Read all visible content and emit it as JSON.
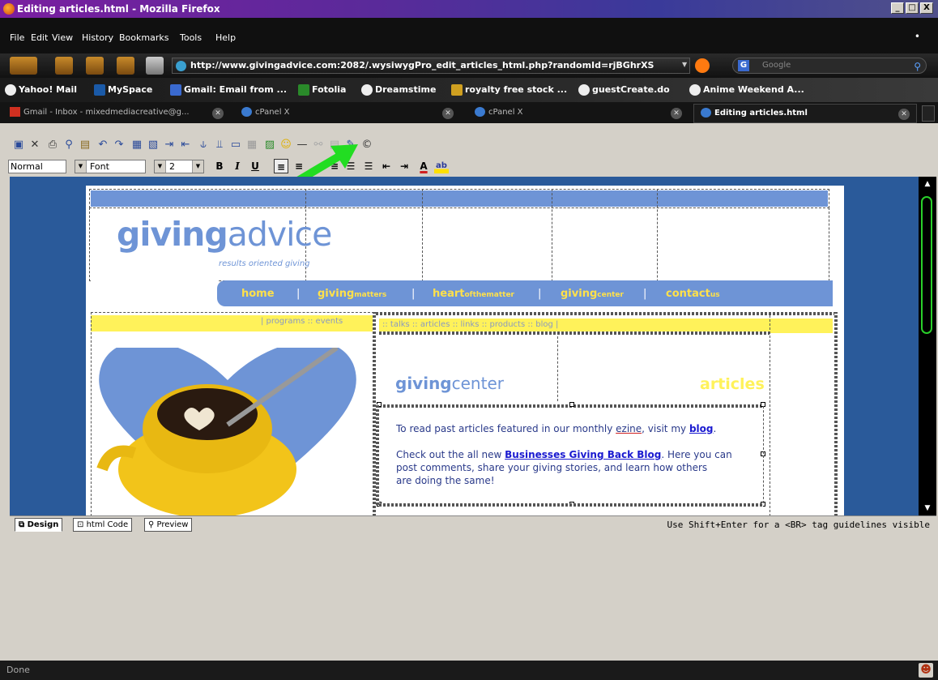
{
  "window": {
    "title": "Editing articles.html - Mozilla Firefox",
    "controls": [
      "_",
      "□",
      "X"
    ]
  },
  "menu": [
    "File",
    "Edit",
    "View",
    "History",
    "Bookmarks",
    "Tools",
    "Help"
  ],
  "address": {
    "url": "http://www.givingadvice.com:2082/.wysiwygPro_edit_articles_html.php?randomId=rjBGhrXS"
  },
  "search": {
    "placeholder": "Google"
  },
  "bookmarks": [
    "Yahoo! Mail",
    "MySpace",
    "Gmail: Email from ...",
    "Fotolia",
    "Dreamstime",
    "royalty free stock ...",
    "guestCreate.do",
    "Anime Weekend A..."
  ],
  "tabs": [
    {
      "label": "Gmail - Inbox - mixedmediacreative@g..."
    },
    {
      "label": "cPanel X"
    },
    {
      "label": "cPanel X"
    },
    {
      "label": "Editing articles.html"
    }
  ],
  "format": {
    "style": "Normal",
    "font": "Font",
    "size": "2"
  },
  "site": {
    "logo_bold": "giving",
    "logo_light": "advice",
    "tagline": "results oriented giving",
    "nav": [
      {
        "bold": "home",
        "small": ""
      },
      {
        "bold": "giving",
        "small": "matters"
      },
      {
        "bold": "heart",
        "small": "ofthematter"
      },
      {
        "bold": "giving",
        "small": "center"
      },
      {
        "bold": "contact",
        "small": "us"
      }
    ],
    "left_links": "|   programs  ::  events",
    "right_links": "::  talks  ::  articles  ::  links  ::  products  ::  blog   |",
    "section_bold": "giving",
    "section_light": "center",
    "articles_heading": "articles",
    "p1_before": "To read past articles featured in our monthly ",
    "p1_ezine": "ezine",
    "p1_mid": ", visit my ",
    "p1_link": "blog",
    "p1_end": ".",
    "p2_before": "Check out the all new ",
    "p2_link": "Businesses Giving Back Blog",
    "p2_rest1": ". Here you can",
    "p2_rest2": "post comments, share your giving stories, and learn how others",
    "p2_rest3": "are doing the same!"
  },
  "modes": [
    "Design",
    "html Code",
    "Preview"
  ],
  "editor_hint": "Use Shift+Enter for a <BR> tag  guidelines visible",
  "status": "Done",
  "colors": {
    "brand_blue": "#6e94d6",
    "brand_yellow": "#fff25a",
    "editor_bg": "#2a5a9a",
    "arrow_green": "#22dd22"
  }
}
